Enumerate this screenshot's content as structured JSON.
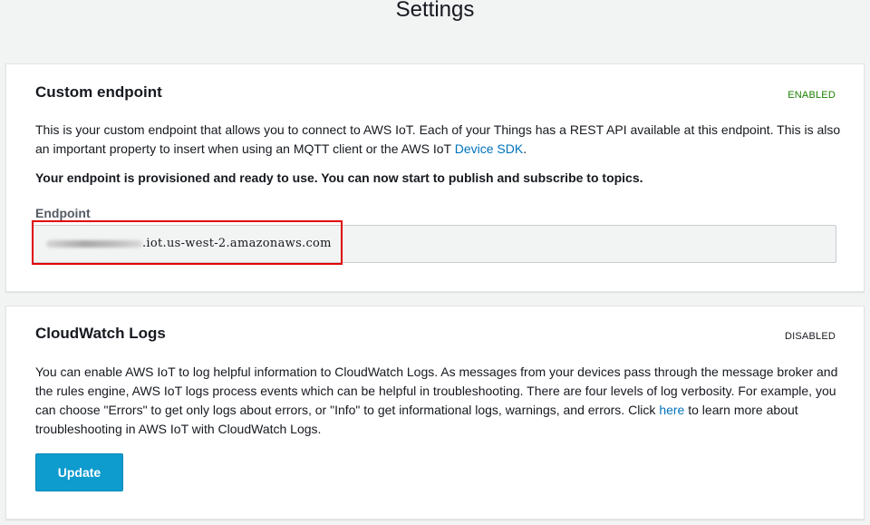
{
  "page": {
    "title": "Settings"
  },
  "custom_endpoint": {
    "title": "Custom endpoint",
    "status": "ENABLED",
    "description_part1": "This is your custom endpoint that allows you to connect to AWS IoT. Each of your Things has a REST API available at this endpoint. This is also an important property to insert when using an MQTT client or the AWS IoT ",
    "description_link": "Device SDK",
    "description_part2": ".",
    "notice": "Your endpoint is provisioned and ready to use. You can now start to publish and subscribe to topics.",
    "field_label": "Endpoint",
    "endpoint_value": ".iot.us-west-2.amazonaws.com"
  },
  "cloudwatch_logs": {
    "title": "CloudWatch Logs",
    "status": "DISABLED",
    "description_part1": "You can enable AWS IoT to log helpful information to CloudWatch Logs. As messages from your devices pass through the message broker and the rules engine, AWS IoT logs process events which can be helpful in troubleshooting. There are four levels of log verbosity. For example, you can choose \"Errors\" to get only logs about errors, or \"Info\" to get informational logs, warnings, and errors. Click ",
    "description_link": "here",
    "description_part2": " to learn more about troubleshooting in AWS IoT with CloudWatch Logs.",
    "update_button": "Update"
  },
  "colors": {
    "link": "#0073bb",
    "enabled_status": "#1d8102",
    "primary_button": "#0e9bce",
    "highlight": "#e00000",
    "page_background": "#f2f3f3"
  }
}
